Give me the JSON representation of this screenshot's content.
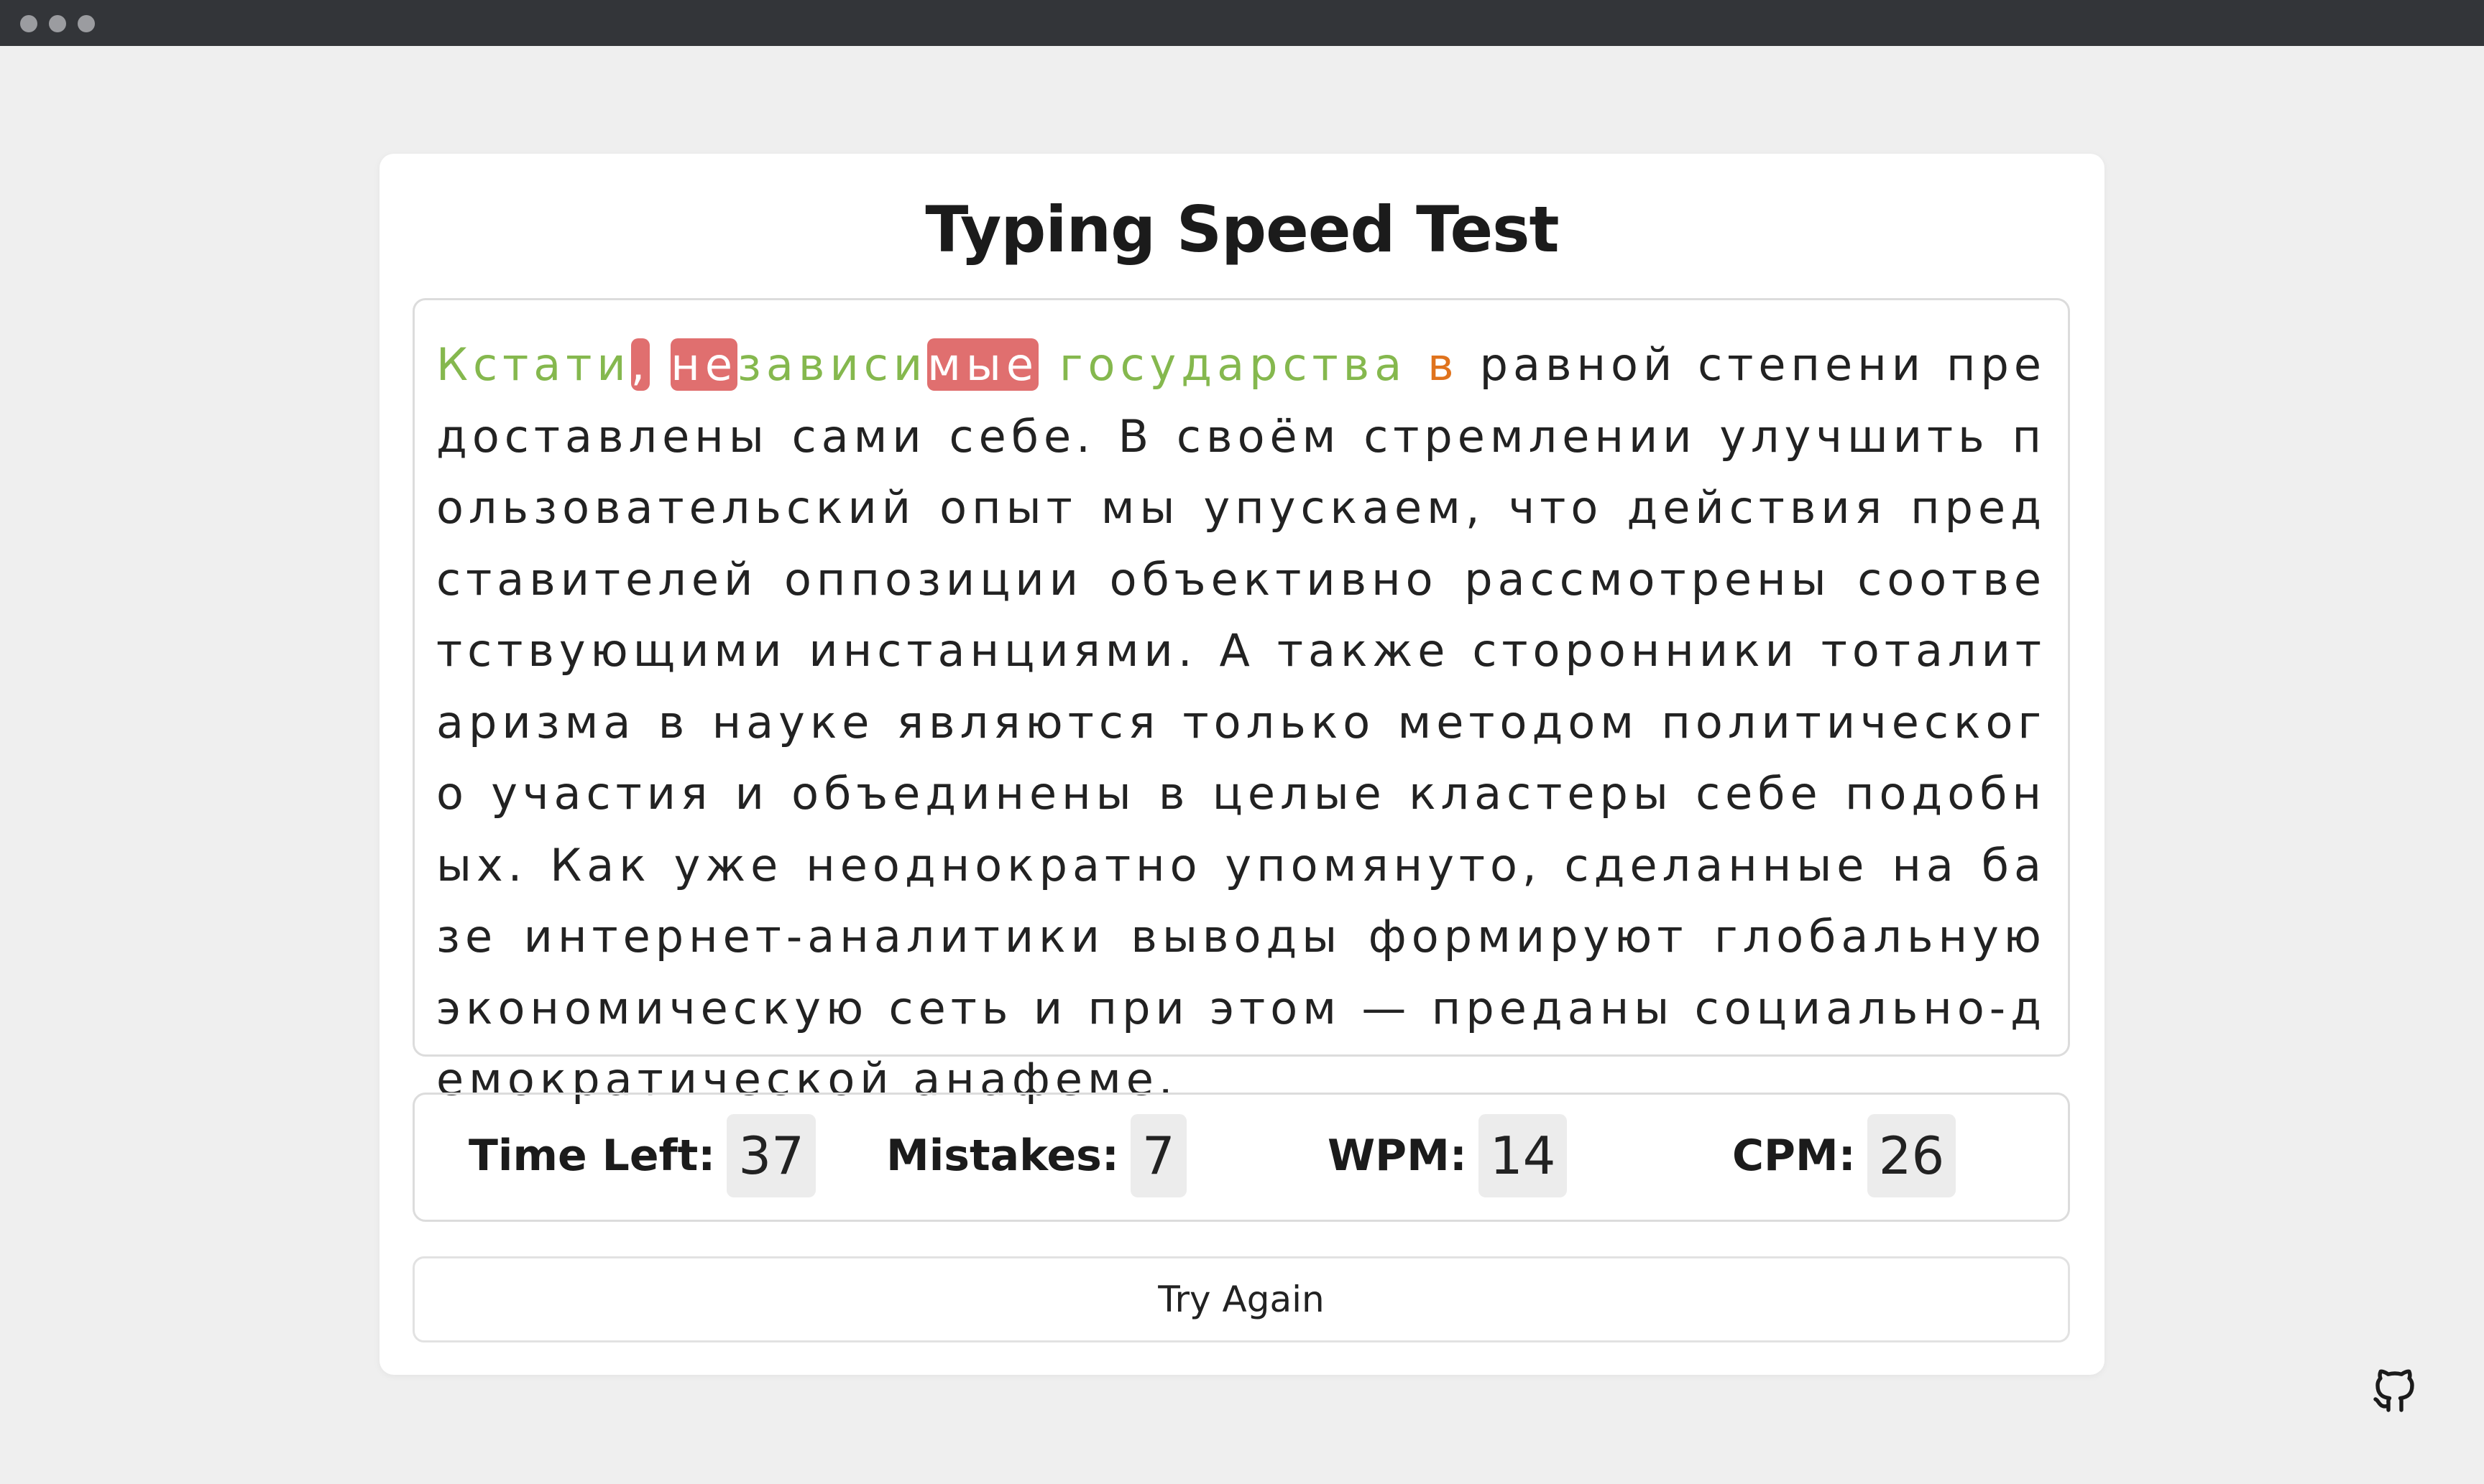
{
  "window": {
    "title_bar_dots": [
      "close",
      "minimize",
      "maximize"
    ]
  },
  "app": {
    "title": "Typing Speed Test"
  },
  "typing_text": {
    "segments": [
      {
        "text": "Кстати",
        "state": "correct"
      },
      {
        "text": ",",
        "state": "wrong"
      },
      {
        "text": " ",
        "state": "correct"
      },
      {
        "text": "не",
        "state": "wrong"
      },
      {
        "text": "зависи",
        "state": "correct"
      },
      {
        "text": "мые",
        "state": "wrong"
      },
      {
        "text": " государства ",
        "state": "correct"
      },
      {
        "text": "в",
        "state": "active"
      },
      {
        "text": " равной степени предоставлены сами себе. В своём стремлении улучшить пользовательский опыт мы упускаем, что действия представителей оппозиции объективно рассмотрены соответствующими инстанциями. А также сторонники тоталитаризма в науке являются только методом политического участия и объединены в целые кластеры себе подобных. Как уже неоднократно упомянуто, сделанные на базе интернет-аналитики выводы формируют глобальную экономическую сеть и при этом — преданы социально-демократической анафеме.",
        "state": "pending"
      }
    ],
    "colors": {
      "correct": "#85b84e",
      "wrong_bg": "#e06f6f",
      "active": "#e0731d",
      "pending": "#222222"
    }
  },
  "stats": {
    "time_left_label": "Time Left:",
    "time_left_value": "37",
    "mistakes_label": "Mistakes:",
    "mistakes_value": "7",
    "wpm_label": "WPM:",
    "wpm_value": "14",
    "cpm_label": "CPM:",
    "cpm_value": "26"
  },
  "actions": {
    "try_again_label": "Try Again"
  },
  "footer": {
    "github_icon": "github-icon"
  }
}
